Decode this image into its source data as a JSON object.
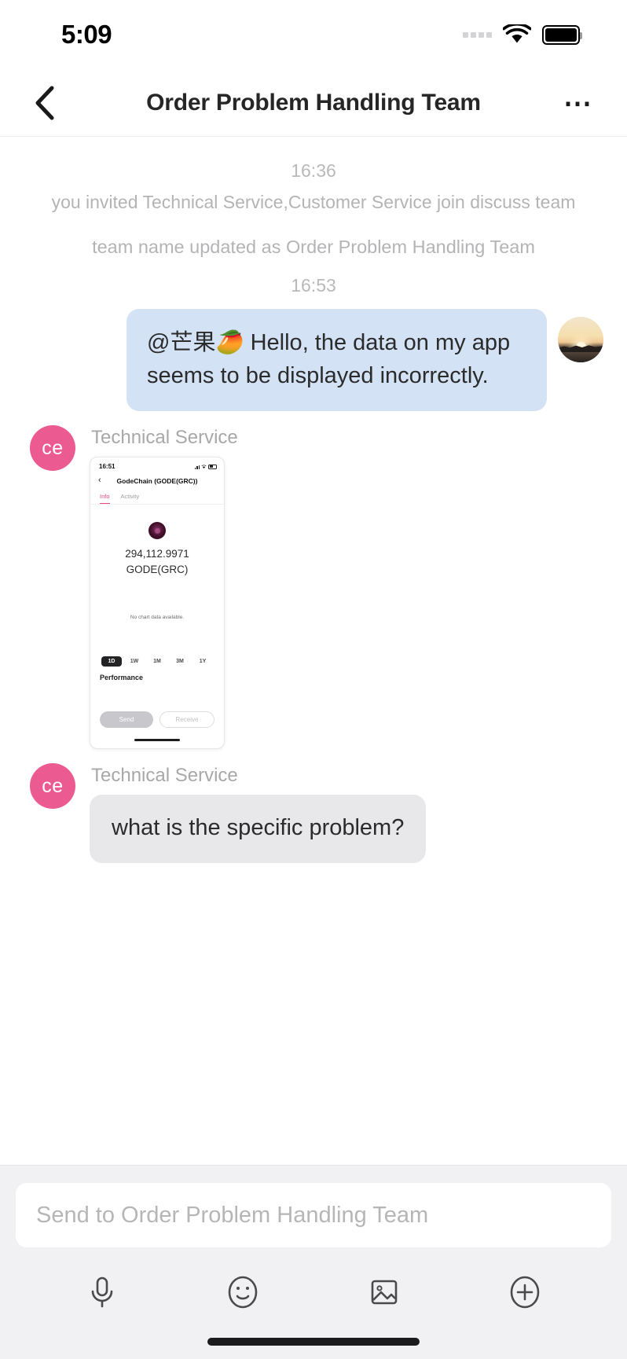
{
  "status_bar": {
    "time": "5:09",
    "signal_icon": "signal-dots-icon",
    "wifi_icon": "wifi-icon",
    "battery_icon": "battery-icon"
  },
  "nav": {
    "back_icon": "chevron-left-icon",
    "title": "Order Problem Handling Team",
    "more_icon": "more-horizontal-icon"
  },
  "chat": {
    "timestamp_1": "16:36",
    "system_invite": "you invited Technical Service,Customer Service join discuss team",
    "system_rename": "team name updated as Order Problem Handling Team",
    "timestamp_2": "16:53",
    "outgoing": {
      "text": "@芒果🥭 Hello, the data on my app seems to be displayed incorrectly.",
      "avatar_name": "sunset-photo-avatar"
    },
    "incoming_image": {
      "sender": "Technical Service",
      "avatar_initials": "ce",
      "avatar_color": "#ec5a92"
    },
    "incoming_text": {
      "sender": "Technical Service",
      "avatar_initials": "ce",
      "text": "what is the specific problem?"
    }
  },
  "embedded_screenshot": {
    "status_time": "16:51",
    "back_icon": "chevron-left-icon",
    "title": "GodeChain (GODE(GRC))",
    "tabs": [
      {
        "label": "Info",
        "active": true
      },
      {
        "label": "Activity",
        "active": false
      }
    ],
    "token_icon": "gode-token-icon",
    "balance": "294,112.9971",
    "symbol": "GODE(GRC)",
    "chart_empty_message": "No chart data available.",
    "ranges": [
      {
        "label": "1D",
        "selected": true
      },
      {
        "label": "1W",
        "selected": false
      },
      {
        "label": "1M",
        "selected": false
      },
      {
        "label": "3M",
        "selected": false
      },
      {
        "label": "1Y",
        "selected": false
      }
    ],
    "section_label": "Performance",
    "send_label": "Send",
    "receive_label": "Receive"
  },
  "composer": {
    "placeholder": "Send to Order Problem Handling Team",
    "value": "",
    "tools": [
      {
        "name": "microphone-icon"
      },
      {
        "name": "emoji-icon"
      },
      {
        "name": "image-icon"
      },
      {
        "name": "plus-icon"
      }
    ]
  }
}
